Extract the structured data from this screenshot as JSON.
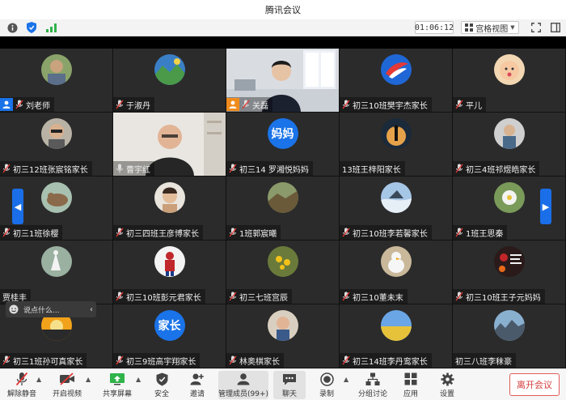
{
  "window": {
    "title": "腾讯会议"
  },
  "status": {
    "timer": "01:06:12",
    "view_label": "宫格视图"
  },
  "tiles": [
    {
      "name": "刘老师"
    },
    {
      "name": "于淑丹"
    },
    {
      "name": "关磊"
    },
    {
      "name": "初三10班樊宇杰家长"
    },
    {
      "name": "平儿"
    },
    {
      "name": "初三12班张宸铭家长"
    },
    {
      "name": "曹宇红"
    },
    {
      "name": "初三14 罗湘悦妈妈",
      "avatar_text": "妈妈"
    },
    {
      "name": "13班王梓阳家长"
    },
    {
      "name": "初三4班祁煜皓家长"
    },
    {
      "name": "初三1班徐樱"
    },
    {
      "name": "初三四班王彦博家长"
    },
    {
      "name": "1班郭宸曦"
    },
    {
      "name": "初三10班李若馨家长"
    },
    {
      "name": "1班王思秦"
    },
    {
      "name": "贾桂丰"
    },
    {
      "name": "初三10班彭元君家长"
    },
    {
      "name": "初三七班宫辰"
    },
    {
      "name": "初三10董未末"
    },
    {
      "name": "初三10班王子元妈妈"
    },
    {
      "name": "初三1班孙可真家长"
    },
    {
      "name": "初三9班高宇翔家长",
      "avatar_text": "家长"
    },
    {
      "name": "林奥棋家长"
    },
    {
      "name": "初三14班李丹鸾家长"
    },
    {
      "name": "初三八班李秣豪"
    }
  ],
  "chat": {
    "placeholder": "说点什么..."
  },
  "toolbar": {
    "mute": "解除静音",
    "video": "开启视频",
    "share": "共享屏幕",
    "security": "安全",
    "invite": "邀请",
    "members": "管理成员(99+)",
    "chat": "聊天",
    "record": "录制",
    "breakout": "分组讨论",
    "apps": "应用",
    "settings": "设置",
    "leave": "离开会议"
  },
  "colors": {
    "accent": "#1a73e8",
    "host_badge": "#1a73e8",
    "cohost_badge": "#f08c1c",
    "leave": "#d43c3c"
  }
}
